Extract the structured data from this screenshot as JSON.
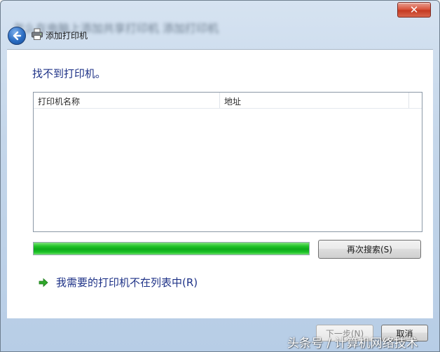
{
  "window": {
    "title_bar_text": "怎么在电脑上添加共享打印机 添加打印机",
    "close_glyph": "✕",
    "subtitle": "添加打印机"
  },
  "main": {
    "heading": "找不到打印机。",
    "list": {
      "columns": [
        "打印机名称",
        "地址"
      ],
      "rows": []
    },
    "progress": {
      "value_percent": 100,
      "color": "#19b92a"
    },
    "search_again_button": "再次搜索(S)",
    "not_listed_link": "我需要的打印机不在列表中(R)"
  },
  "footer": {
    "next_button": "下一步(N)",
    "cancel_button": "取消"
  },
  "watermark": "头条号 / 计算机网络技术",
  "icons": {
    "back": "back-arrow-icon",
    "printer": "printer-icon",
    "link_arrow": "green-arrow-icon",
    "close": "close-icon"
  }
}
